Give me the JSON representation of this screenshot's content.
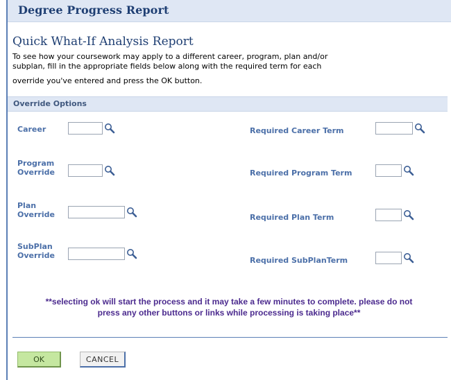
{
  "page": {
    "header": "Degree Progress Report",
    "title": "Quick What-If Analysis Report",
    "instructions_line1": "To see how your coursework may apply to a different career, program, plan and/or",
    "instructions_line2": "subplan, fill in the appropriate fields below along with the required term for each",
    "instructions_line3": "override you've entered and press the OK button."
  },
  "override_options": {
    "section_title": "Override Options",
    "career": {
      "label": "Career",
      "value": ""
    },
    "program": {
      "label_line1": "Program",
      "label_line2": "Override",
      "value": ""
    },
    "plan": {
      "label_line1": "Plan",
      "label_line2": "Override",
      "value": ""
    },
    "subplan": {
      "label_line1": "SubPlan",
      "label_line2": "Override",
      "value": ""
    },
    "required_career_term": {
      "label": "Required Career Term",
      "value": ""
    },
    "required_program_term": {
      "label": "Required Program Term",
      "value": ""
    },
    "required_plan_term": {
      "label": "Required Plan Term",
      "value": ""
    },
    "required_subplan_term": {
      "label": "Required SubPlanTerm",
      "value": ""
    },
    "lookup_icon": "magnifier-lookup-icon"
  },
  "note": {
    "line1": "**selecting ok will start the process and it may take a few minutes to complete. please do not",
    "line2": "press any other buttons or links while processing is taking place**"
  },
  "buttons": {
    "ok": "OK",
    "cancel": "CANCEL"
  },
  "colors": {
    "header_text": "#1f3f73",
    "label_text": "#4b6fa8",
    "note_text": "#4b2a8e",
    "ok_button": "#c5e7a0",
    "section_bar": "#dfe7f4"
  }
}
